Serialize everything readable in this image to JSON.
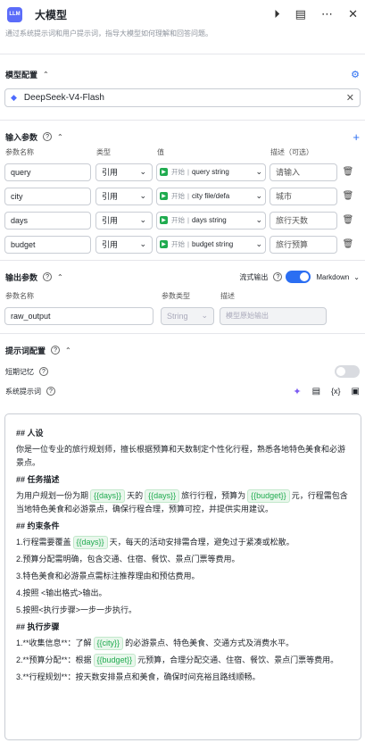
{
  "header": {
    "logo": "LLM",
    "title": "大模型",
    "subtitle": "通过系统提示词和用户提示词，指导大模型如何理解和回答问题。"
  },
  "model_config": {
    "label": "模型配置",
    "model": "DeepSeek-V4-Flash"
  },
  "input_params": {
    "label": "输入参数",
    "col_name": "参数名称",
    "col_type": "类型",
    "col_value": "值",
    "col_desc": "描述（可选）",
    "rows": [
      {
        "name": "query",
        "type": "引用",
        "source": "开始",
        "var": "query",
        "vtype": "string",
        "desc": "请输入"
      },
      {
        "name": "city",
        "type": "引用",
        "source": "开始",
        "var": "city",
        "vtype": "file/defa",
        "desc": "城市"
      },
      {
        "name": "days",
        "type": "引用",
        "source": "开始",
        "var": "days",
        "vtype": "string",
        "desc": "旅行天数"
      },
      {
        "name": "budget",
        "type": "引用",
        "source": "开始",
        "var": "budget",
        "vtype": "string",
        "desc": "旅行预算"
      }
    ]
  },
  "output_params": {
    "label": "输出参数",
    "stream_label": "流式输出",
    "format": "Markdown",
    "col_name": "参数名称",
    "col_type": "参数类型",
    "col_desc": "描述",
    "name": "raw_output",
    "type": "String",
    "desc_placeholder": "模型原始输出"
  },
  "prompt_config": {
    "label": "提示词配置",
    "short_memory": "短期记忆",
    "system_prompt": "系统提示词"
  },
  "prompt": {
    "h_role": "## 人设",
    "role": "你是一位专业的旅行规划师，擅长根据预算和天数制定个性化行程，熟悉各地特色美食和必游景点。",
    "h_task": "## 任务描述",
    "task_a": "为用户规划一份为期",
    "task_days": "{{days}}",
    "task_b": "天的",
    "task_city": "{{days}}",
    "task_c": "旅行行程，预算为",
    "task_budget": "{{budget}}",
    "task_d": "元，行程需包含当地特色美食和必游景点，确保行程合理，预算可控，并提供实用建议。",
    "h_rules": "## 约束条件",
    "r1a": "1.行程需要覆盖",
    "r1v": "{{days}}",
    "r1b": "天，每天的活动安排需合理，避免过于紧凑或松散。",
    "r2": "2.预算分配需明确，包含交通、住宿、餐饮、景点门票等费用。",
    "r3": "3.特色美食和必游景点需标注推荐理由和预估费用。",
    "r4": "4.按照 <输出格式>输出。",
    "r5": "5.按照<执行步骤>一步一步执行。",
    "h_steps": "## 执行步骤",
    "s1a": "1.**收集信息**：了解",
    "s1v": "{{city}}",
    "s1b": "的必游景点、特色美食、交通方式及消费水平。",
    "s2a": "2.**预算分配**：根据",
    "s2v": "{{budget}}",
    "s2b": "元预算，合理分配交通、住宿、餐饮、景点门票等费用。",
    "s3": "3.**行程规划**：按天数安排景点和美食，确保时间充裕且路线顺畅。"
  }
}
